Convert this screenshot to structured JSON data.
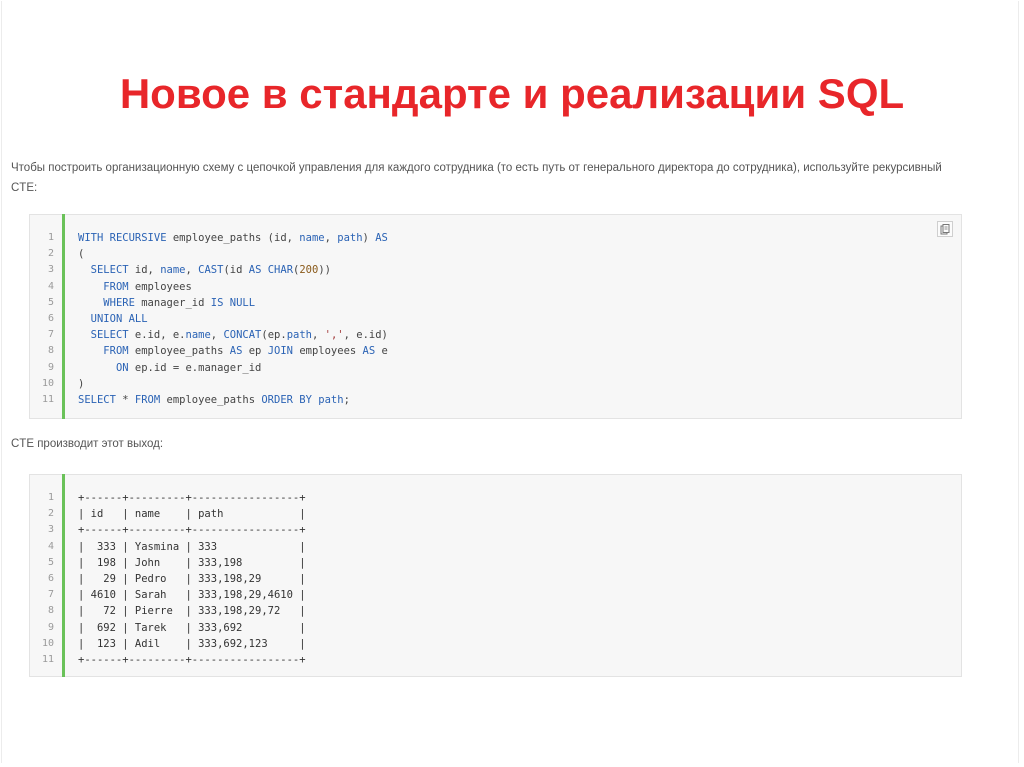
{
  "slide": {
    "title": "Новое в стандарте и реализации SQL",
    "intro_text": "Чтобы построить организационную схему с цепочкой управления для каждого сотрудника (то есть путь от генерального директора до сотрудника), используйте рекурсивный CTE:",
    "output_label": "CTE производит этот выход:"
  },
  "colors": {
    "title": "#e8262a",
    "accent_bar": "#6ac259",
    "keyword": "#2b63b5"
  },
  "icons": {
    "copy": "clipboard-copy-icon"
  },
  "code_block": {
    "lines": [
      {
        "n": "1",
        "text": "WITH RECURSIVE employee_paths (id, name, path) AS"
      },
      {
        "n": "2",
        "text": "("
      },
      {
        "n": "3",
        "text": "  SELECT id, name, CAST(id AS CHAR(200))"
      },
      {
        "n": "4",
        "text": "    FROM employees"
      },
      {
        "n": "5",
        "text": "    WHERE manager_id IS NULL"
      },
      {
        "n": "6",
        "text": "  UNION ALL"
      },
      {
        "n": "7",
        "text": "  SELECT e.id, e.name, CONCAT(ep.path, ',', e.id)"
      },
      {
        "n": "8",
        "text": "    FROM employee_paths AS ep JOIN employees AS e"
      },
      {
        "n": "9",
        "text": "      ON ep.id = e.manager_id"
      },
      {
        "n": "10",
        "text": ")"
      },
      {
        "n": "11",
        "text": "SELECT * FROM employee_paths ORDER BY path;"
      }
    ]
  },
  "output_block": {
    "lines": [
      {
        "n": "1",
        "text": "+------+---------+-----------------+"
      },
      {
        "n": "2",
        "text": "| id   | name    | path            |"
      },
      {
        "n": "3",
        "text": "+------+---------+-----------------+"
      },
      {
        "n": "4",
        "text": "|  333 | Yasmina | 333             |"
      },
      {
        "n": "5",
        "text": "|  198 | John    | 333,198         |"
      },
      {
        "n": "6",
        "text": "|   29 | Pedro   | 333,198,29      |"
      },
      {
        "n": "7",
        "text": "| 4610 | Sarah   | 333,198,29,4610 |"
      },
      {
        "n": "8",
        "text": "|   72 | Pierre  | 333,198,29,72   |"
      },
      {
        "n": "9",
        "text": "|  692 | Tarek   | 333,692         |"
      },
      {
        "n": "10",
        "text": "|  123 | Adil    | 333,692,123     |"
      },
      {
        "n": "11",
        "text": "+------+---------+-----------------+"
      }
    ]
  }
}
